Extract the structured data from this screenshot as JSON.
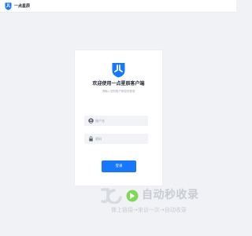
{
  "header": {
    "brand_name": "一点星辰",
    "logo_icon": "brand-logo-icon"
  },
  "login": {
    "logo_icon": "shield-logo-icon",
    "title": "欢迎使用一点星辰客户端",
    "subtitle": "请输入您的账户和密码登录",
    "account_placeholder": "账户名",
    "password_placeholder": "密码",
    "account_icon": "user-icon",
    "password_icon": "lock-icon",
    "submit_label": "登录"
  },
  "watermark": {
    "title": "自动秒收录",
    "slogan": "做上链接→来访一次→自动收录"
  },
  "colors": {
    "accent": "#1677ff",
    "background": "#f0f2f6",
    "card": "#ffffff",
    "field": "#f2f3f6",
    "watermark": "#c9ccd1"
  }
}
